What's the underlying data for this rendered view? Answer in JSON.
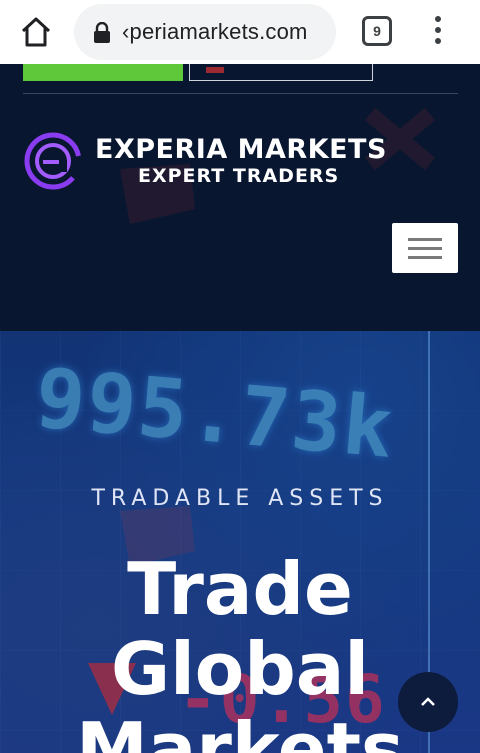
{
  "browser": {
    "url": "experiamarkets.com",
    "url_visible": "‹periamarkets.com",
    "tab_count": "9"
  },
  "header": {
    "brand_name": "EXPERIA MARKETS",
    "brand_tagline": "EXPERT TRADERS"
  },
  "hero": {
    "ticker_value": "995.73k",
    "ticker_negative": "-0.56",
    "eyebrow": "TRADABLE ASSETS",
    "headline_line1": "Trade",
    "headline_line2": "Global",
    "headline_line3": "Markets"
  },
  "colors": {
    "header_bg": "#091630",
    "accent_green": "#5fc83a",
    "logo_purple": "#8a3cf0",
    "hero_blue": "#1c4aa0",
    "ticker_cyan": "#5fc6ff",
    "ticker_red": "#ff3d6b"
  },
  "icons": [
    "home-icon",
    "lock-icon",
    "tab-switcher-icon",
    "overflow-menu-icon",
    "hamburger-menu-icon",
    "chevron-up-icon",
    "experia-logo-icon"
  ]
}
